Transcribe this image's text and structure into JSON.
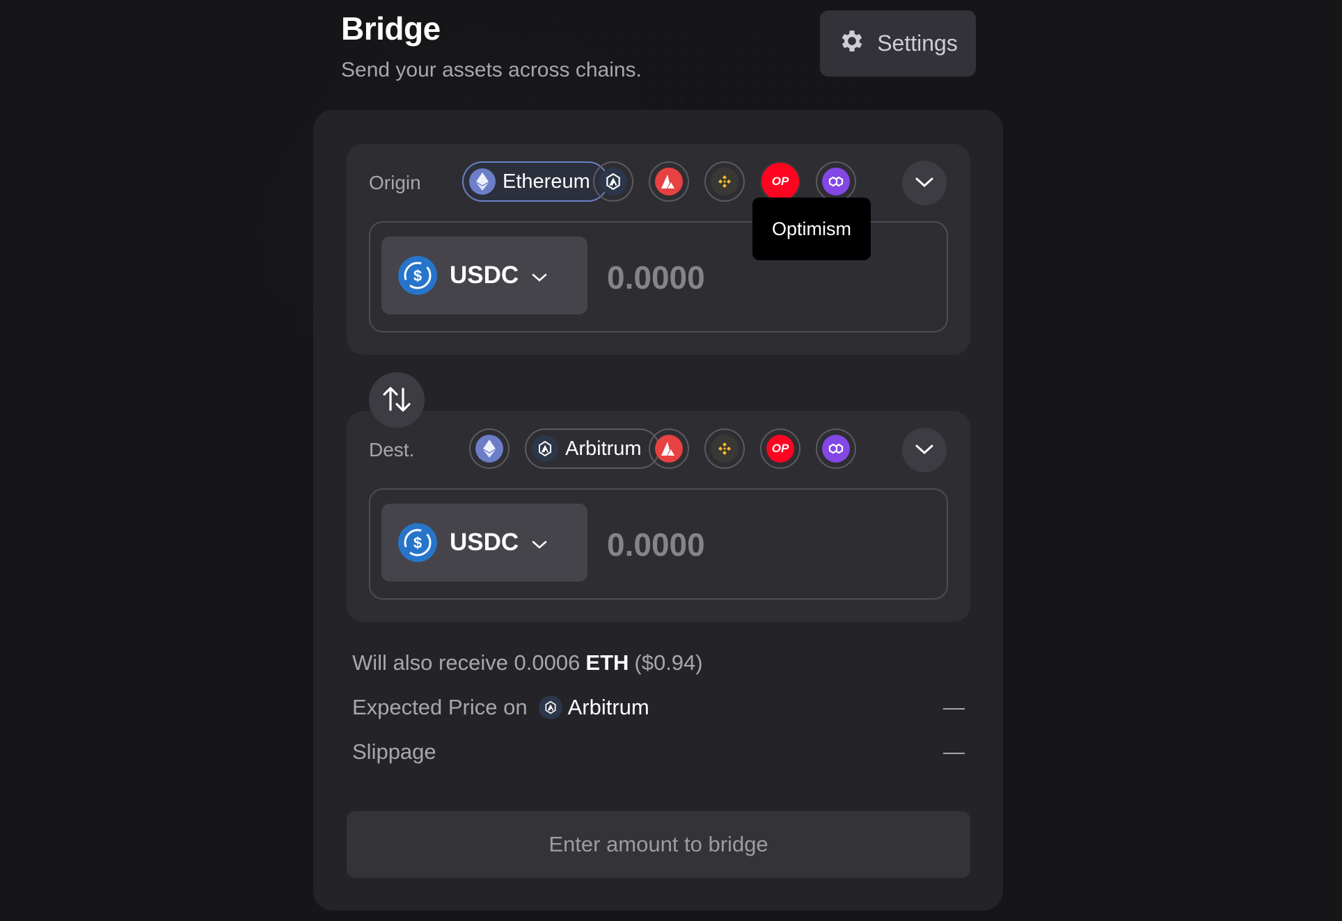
{
  "header": {
    "title": "Bridge",
    "subtitle": "Send your assets across chains."
  },
  "settings": {
    "label": "Settings",
    "icon": "gear-icon"
  },
  "origin": {
    "label": "Origin",
    "selected_chain": "Ethereum",
    "chains": [
      "Arbitrum",
      "Avalanche",
      "BNB Chain",
      "Optimism",
      "Polygon"
    ],
    "token": "USDC",
    "amount_placeholder": "0.0000"
  },
  "tooltip": {
    "text": "Optimism"
  },
  "destination": {
    "label": "Dest.",
    "selected_chain": "Arbitrum",
    "chains": [
      "Ethereum",
      "Avalanche",
      "BNB Chain",
      "Optimism",
      "Polygon"
    ],
    "token": "USDC",
    "amount_placeholder": "0.0000"
  },
  "details": {
    "receive_prefix": "Will also receive 0.0006",
    "receive_token": "ETH",
    "receive_usd": "($0.94)",
    "expected_price_label": "Expected Price on",
    "expected_price_chain": "Arbitrum",
    "expected_price_value": "—",
    "slippage_label": "Slippage",
    "slippage_value": "—"
  },
  "bridge_button": {
    "label": "Enter amount to bridge"
  },
  "colors": {
    "background": "#161518",
    "card": "#242327",
    "panel": "#2e2d32",
    "usdc": "#2775ca",
    "optimism": "#ff0420",
    "avalanche": "#e84142",
    "polygon": "#8247e5"
  }
}
